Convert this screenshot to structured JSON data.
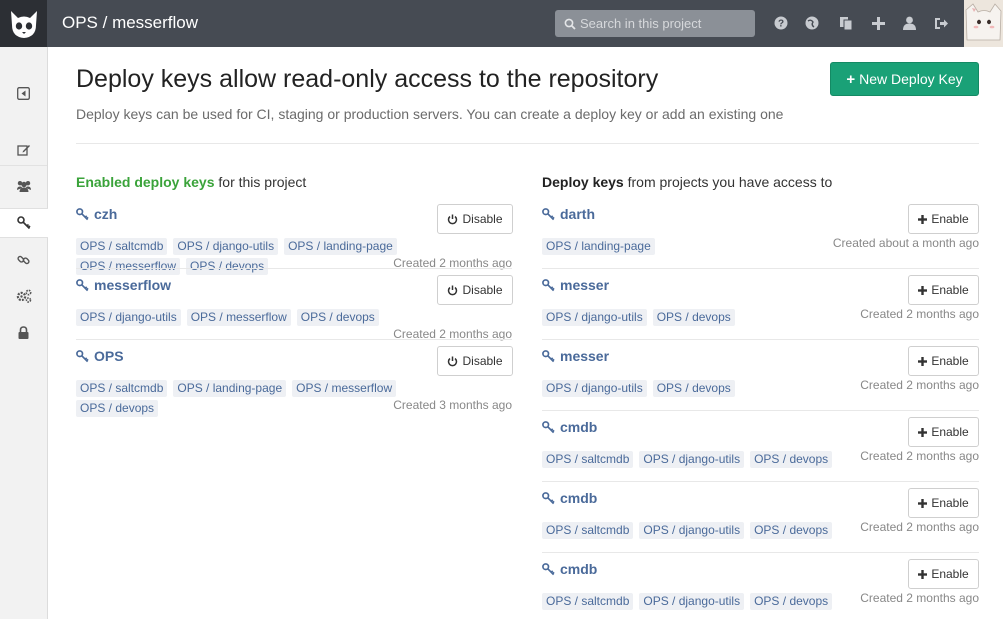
{
  "header": {
    "title": "OPS / messerflow",
    "search_placeholder": "Search in this project",
    "icons": [
      "help-icon",
      "globe-icon",
      "copy-icon",
      "plus-icon",
      "user-icon",
      "logout-icon"
    ]
  },
  "sidebar": {
    "items": [
      "collapse-icon",
      "edit-icon",
      "users-icon",
      "key-icon",
      "link-icon",
      "cogs-icon",
      "lock-icon"
    ],
    "active": "key-icon"
  },
  "main": {
    "title": "Deploy keys allow read-only access to the repository",
    "description": "Deploy keys can be used for CI, staging or production servers. You can create a deploy key or add an existing one",
    "new_button": "New Deploy Key"
  },
  "enabled": {
    "head_strong": "Enabled deploy keys",
    "head_rest": " for this project",
    "keys": [
      {
        "name": "czh",
        "button": "Disable",
        "created": "Created 2 months ago",
        "tags": [
          "OPS / saltcmdb",
          "OPS / django-utils",
          "OPS / landing-page",
          "OPS / messerflow",
          "OPS / devops"
        ]
      },
      {
        "name": "messerflow",
        "button": "Disable",
        "created": "Created 2 months ago",
        "tags": [
          "OPS / django-utils",
          "OPS / messerflow",
          "OPS / devops"
        ]
      },
      {
        "name": "OPS",
        "button": "Disable",
        "created": "Created 3 months ago",
        "tags": [
          "OPS / saltcmdb",
          "OPS / landing-page",
          "OPS / messerflow",
          "OPS / devops"
        ]
      }
    ]
  },
  "available": {
    "head_strong": "Deploy keys",
    "head_rest": " from projects you have access to",
    "keys": [
      {
        "name": "darth",
        "button": "Enable",
        "created": "Created about a month ago",
        "tags": [
          "OPS / landing-page"
        ]
      },
      {
        "name": "messer",
        "button": "Enable",
        "created": "Created 2 months ago",
        "tags": [
          "OPS / django-utils",
          "OPS / devops"
        ]
      },
      {
        "name": "messer",
        "button": "Enable",
        "created": "Created 2 months ago",
        "tags": [
          "OPS / django-utils",
          "OPS / devops"
        ]
      },
      {
        "name": "cmdb",
        "button": "Enable",
        "created": "Created 2 months ago",
        "tags": [
          "OPS / saltcmdb",
          "OPS / django-utils",
          "OPS / devops"
        ]
      },
      {
        "name": "cmdb",
        "button": "Enable",
        "created": "Created 2 months ago",
        "tags": [
          "OPS / saltcmdb",
          "OPS / django-utils",
          "OPS / devops"
        ]
      },
      {
        "name": "cmdb",
        "button": "Enable",
        "created": "Created 2 months ago",
        "tags": [
          "OPS / saltcmdb",
          "OPS / django-utils",
          "OPS / devops"
        ]
      }
    ]
  },
  "colors": {
    "accent_green": "#1aa177",
    "topbar": "#464b53",
    "link": "#4a6a9a",
    "enabled_green": "#3aa33a"
  }
}
